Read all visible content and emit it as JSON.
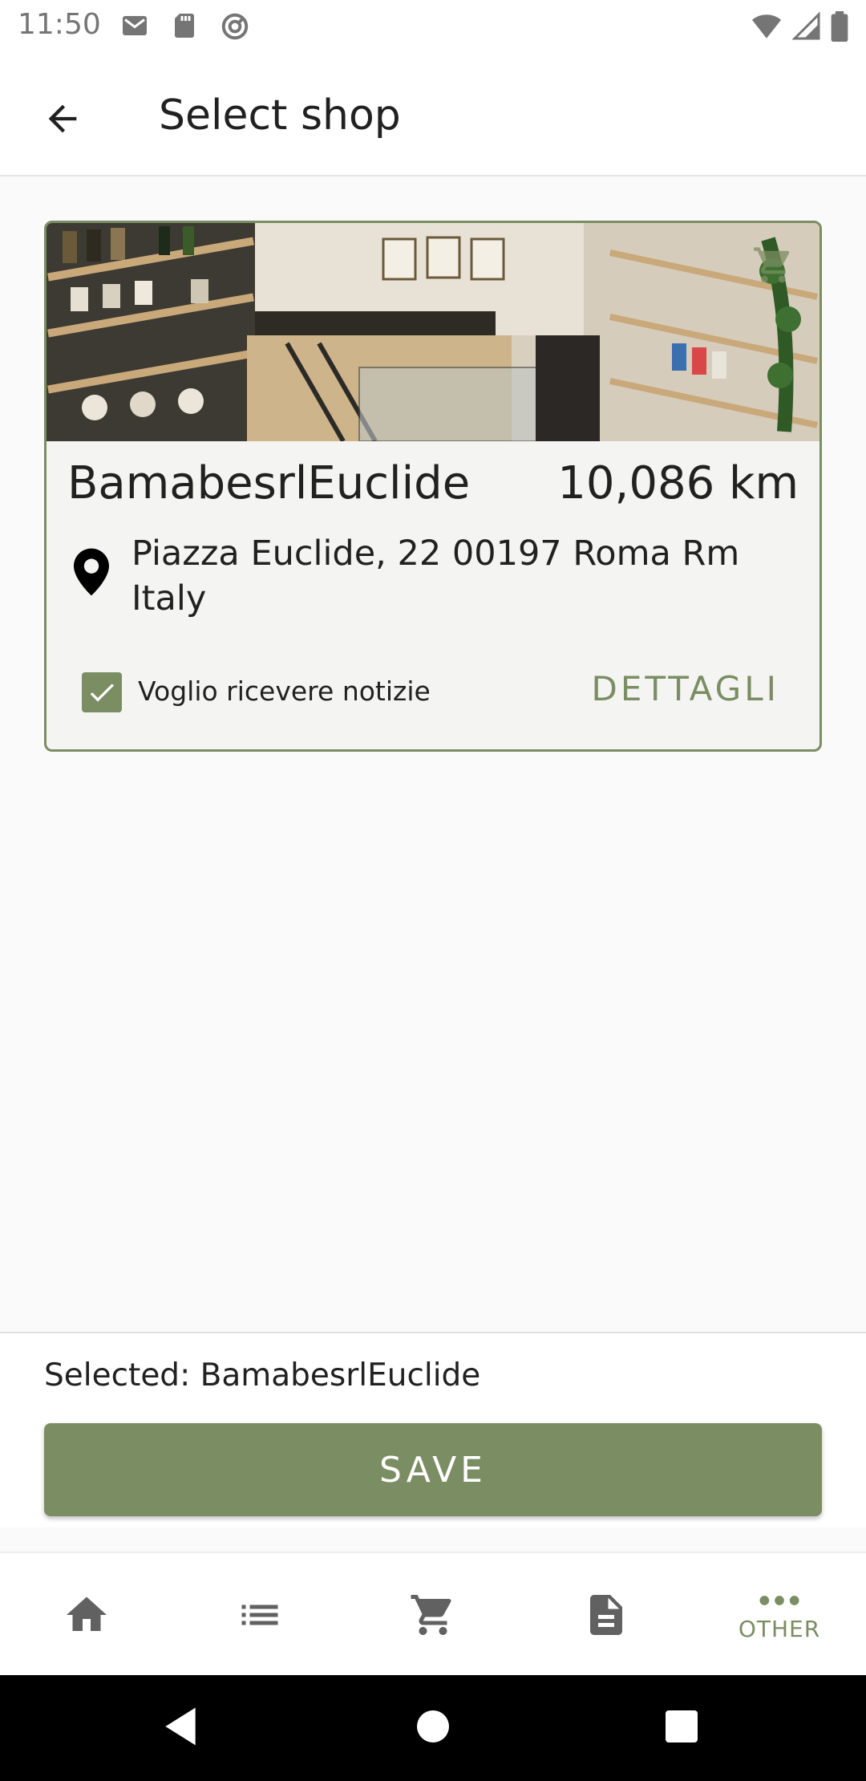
{
  "status_bar": {
    "time": "11:50",
    "left_icons": [
      "gmail-icon",
      "sd-card-icon",
      "sync-icon"
    ],
    "right_icons": [
      "wifi-icon",
      "signal-icon",
      "battery-icon"
    ]
  },
  "app_bar": {
    "back_icon": "arrow-back-icon",
    "title": "Select shop"
  },
  "shop_card": {
    "name": "BamabesrlEuclide",
    "distance": "10,086 km",
    "address": "Piazza Euclide, 22 00197 Roma Rm Italy",
    "checkbox_checked": true,
    "checkbox_label": "Voglio ricevere notizie",
    "details_label": "DETTAGLI",
    "image_icon": "shopping-cart-icon"
  },
  "bottom_panel": {
    "selected_text": "Selected: BamabesrlEuclide",
    "save_label": "SAVE"
  },
  "bottom_nav": {
    "items": [
      {
        "icon": "home-icon",
        "label": ""
      },
      {
        "icon": "list-icon",
        "label": ""
      },
      {
        "icon": "cart-icon",
        "label": ""
      },
      {
        "icon": "document-icon",
        "label": ""
      },
      {
        "icon": "more-icon",
        "label": "OTHER"
      }
    ]
  },
  "colors": {
    "accent": "#7b8d62",
    "text": "#212121",
    "background": "#fafafa",
    "card": "#f4f4f2"
  }
}
